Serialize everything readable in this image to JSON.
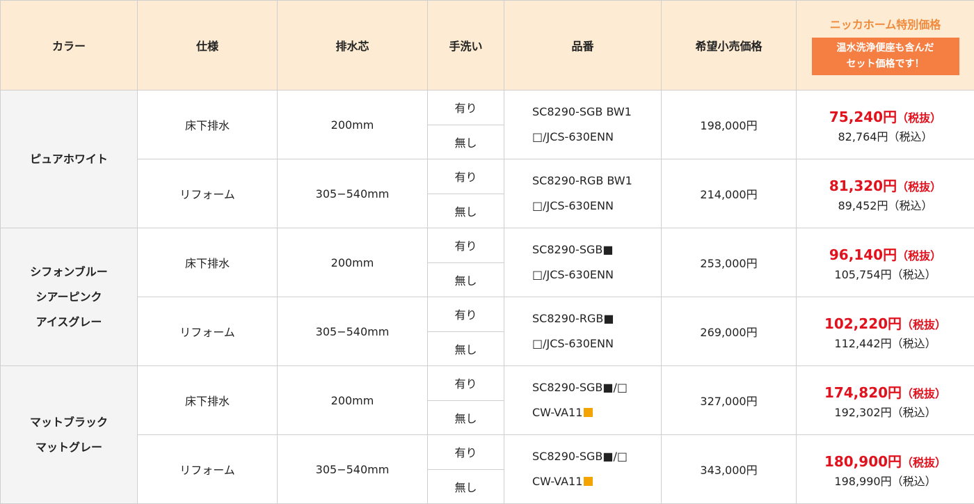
{
  "header": {
    "color": "カラー",
    "spec": "仕様",
    "drain": "排水芯",
    "handwash": "手洗い",
    "part_number": "品番",
    "retail_price": "希望小売価格",
    "special_title": "ニッカホーム特別価格",
    "special_badge_line1": "温水洗浄便座も含んだ",
    "special_badge_line2": "セット価格です！"
  },
  "handwash_options": {
    "with": "有り",
    "without": "無し"
  },
  "groups": [
    {
      "colors": [
        "ピュアホワイト"
      ],
      "rows": [
        {
          "spec": "床下排水",
          "drain": "200mm",
          "part_line1": "SC8290-SGB BW1",
          "part_line2": "□/JCS-630ENN",
          "retail": "198,000円",
          "price_excl": "75,240円",
          "tax_excl_label": "（税抜）",
          "price_incl": "82,764円（税込）"
        },
        {
          "spec": "リフォーム",
          "drain": "305−540mm",
          "part_line1": "SC8290-RGB BW1",
          "part_line2": "□/JCS-630ENN",
          "retail": "214,000円",
          "price_excl": "81,320円",
          "tax_excl_label": "（税抜）",
          "price_incl": "89,452円（税込）"
        }
      ]
    },
    {
      "colors": [
        "シフォンブルー",
        "シアーピンク",
        "アイスグレー"
      ],
      "rows": [
        {
          "spec": "床下排水",
          "drain": "200mm",
          "part_line1": "SC8290-SGB■",
          "part_line2": "□/JCS-630ENN",
          "retail": "253,000円",
          "price_excl": "96,140円",
          "tax_excl_label": "（税抜）",
          "price_incl": "105,754円（税込）"
        },
        {
          "spec": "リフォーム",
          "drain": "305−540mm",
          "part_line1": "SC8290-RGB■",
          "part_line2": "□/JCS-630ENN",
          "retail": "269,000円",
          "price_excl": "102,220円",
          "tax_excl_label": "（税抜）",
          "price_incl": "112,442円（税込）"
        }
      ]
    },
    {
      "colors": [
        "マットブラック",
        "マットグレー"
      ],
      "rows": [
        {
          "spec": "床下排水",
          "drain": "200mm",
          "part_line1": "SC8290-SGB■/□",
          "part_line2": "CW-VA11",
          "retail": "327,000円",
          "price_excl": "174,820円",
          "tax_excl_label": "（税抜）",
          "price_incl": "192,302円（税込）"
        },
        {
          "spec": "リフォーム",
          "drain": "305−540mm",
          "part_line1": "SC8290-SGB■/□",
          "part_line2": "CW-VA11",
          "retail": "343,000円",
          "price_excl": "180,900円",
          "tax_excl_label": "（税抜）",
          "price_incl": "198,990円（税込）"
        }
      ]
    }
  ],
  "colors": {
    "header_bg": "#fdebd3",
    "color_cell_bg": "#f4f4f4",
    "special_title": "#f08a3c",
    "special_badge_bg": "#f57e42",
    "price_red": "#e0121e",
    "orange_square": "#f4a400"
  }
}
